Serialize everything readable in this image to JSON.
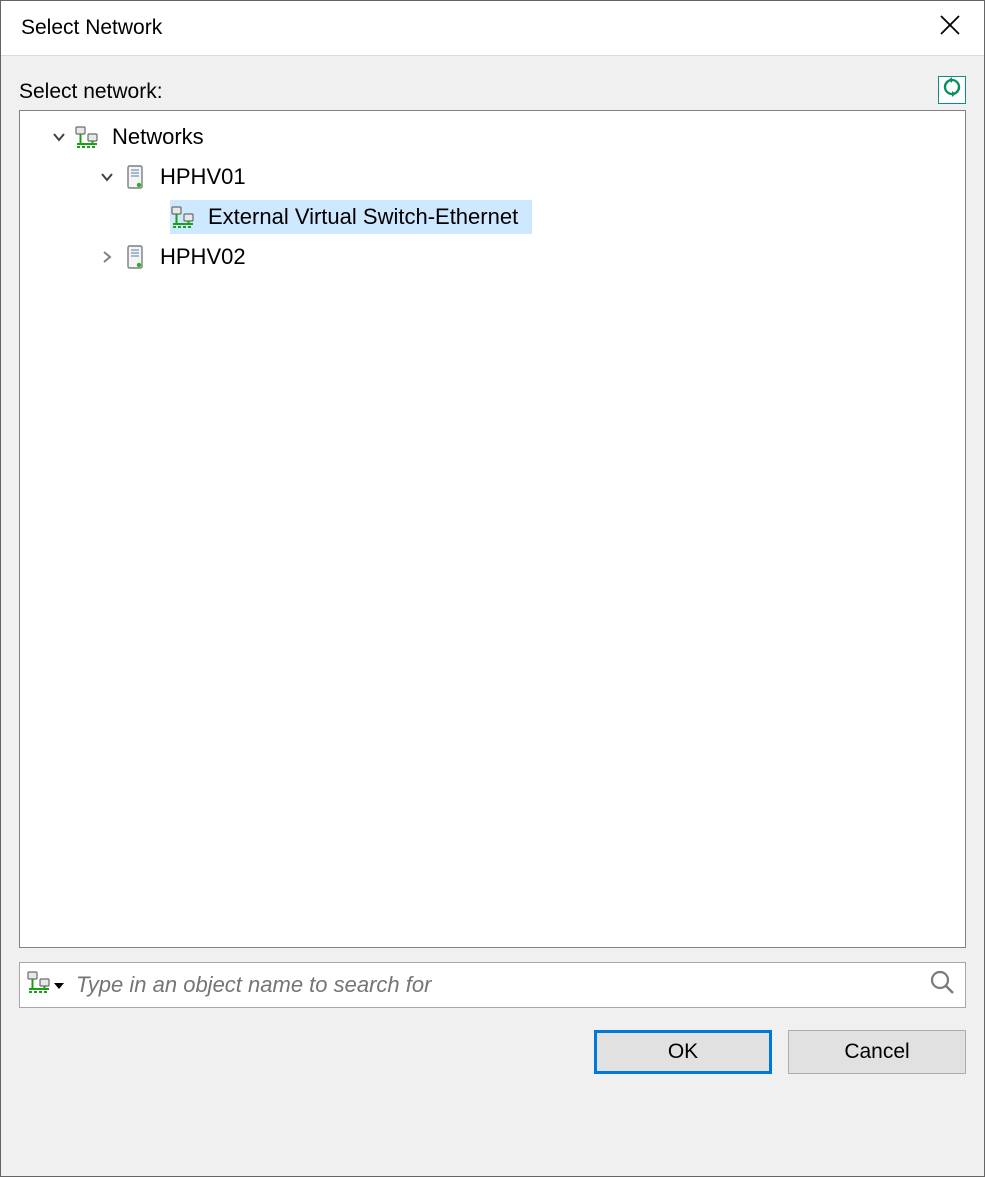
{
  "window": {
    "title": "Select Network"
  },
  "label": "Select network:",
  "tree": {
    "root": {
      "label": "Networks",
      "nodes": [
        {
          "label": "HPHV01",
          "expanded": true,
          "children": [
            {
              "label": "External Virtual Switch-Ethernet",
              "selected": true
            }
          ]
        },
        {
          "label": "HPHV02",
          "expanded": false
        }
      ]
    }
  },
  "search": {
    "placeholder": "Type in an object name to search for"
  },
  "buttons": {
    "ok": "OK",
    "cancel": "Cancel"
  }
}
